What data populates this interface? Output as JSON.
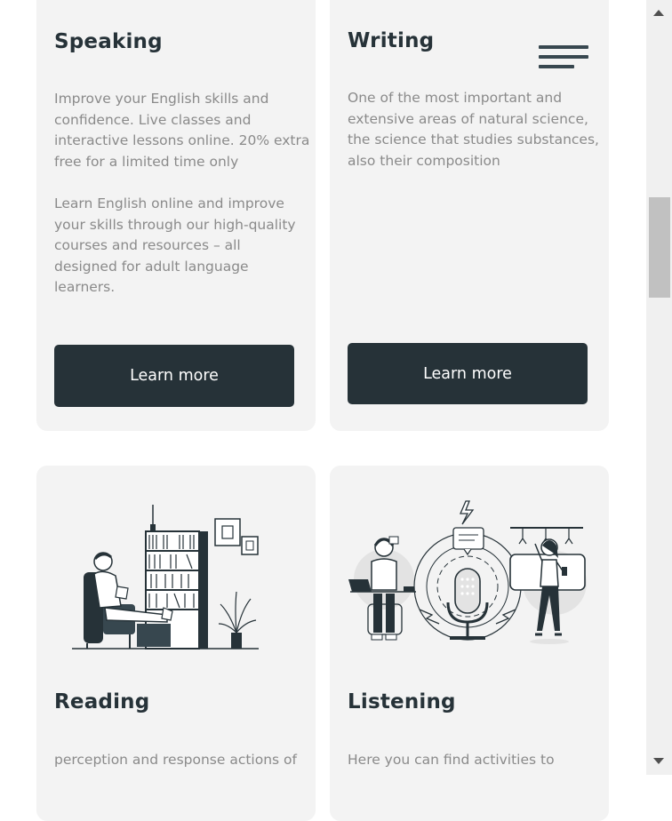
{
  "cards": {
    "speaking": {
      "title": "Speaking",
      "paragraph1": [
        "Improve your English skills and",
        "confidence. Live classes and",
        "interactive lessons online. 20% extra",
        "free for a limited time only"
      ],
      "paragraph2": [
        "Learn English online and improve",
        "your skills through our high-quality",
        "courses and resources – all",
        "designed for adult language",
        "learners."
      ],
      "button": "Learn more"
    },
    "writing": {
      "title": "Writing",
      "paragraph1": [
        "One of the most important and",
        "extensive areas of natural science,",
        "the science that studies substances,",
        "also their composition"
      ],
      "button": "Learn more"
    },
    "reading": {
      "title": "Reading",
      "paragraph1": [
        "perception and response actions of"
      ]
    },
    "listening": {
      "title": "Listening",
      "paragraph1": [
        "Here you can find activities to"
      ]
    }
  },
  "icons": {
    "menu": "hamburger-menu-icon",
    "scroll_up": "triangle-up-icon",
    "scroll_down": "triangle-down-icon"
  },
  "colors": {
    "card_bg": "#f3f3f3",
    "dark": "#263238",
    "text_muted": "#8a8a8a"
  }
}
